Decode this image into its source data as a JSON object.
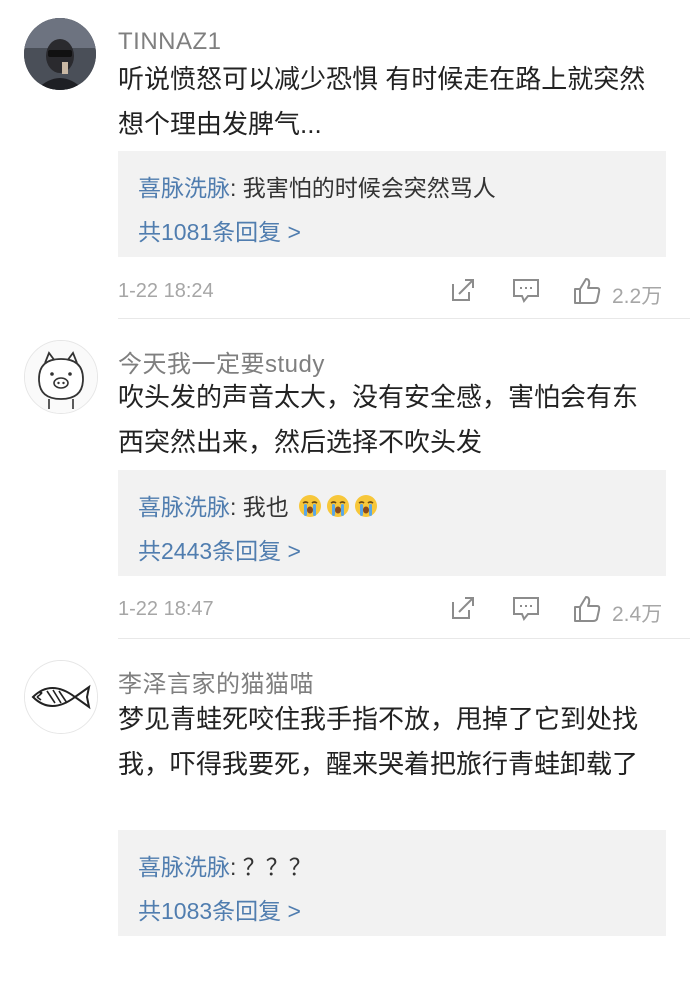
{
  "comments": [
    {
      "username": "TINNAZ1",
      "avatar": "photo-avatar",
      "text": "听说愤怒可以减少恐惧 有时候走在路上就突然想个理由发脾气...",
      "reply": {
        "author": "喜脉洗脉",
        "text": ": 我害怕的时候会突然骂人",
        "count_label": "共1081条回复 >"
      },
      "timestamp": "1-22 18:24",
      "likes": "2.2万"
    },
    {
      "username": "今天我一定要study",
      "avatar": "pig-avatar",
      "text": "吹头发的声音太大，没有安全感，害怕会有东西突然出来，然后选择不吹头发",
      "reply": {
        "author": "喜脉洗脉",
        "text": ": 我也",
        "emoji": "crying-emoji x3",
        "count_label": "共2443条回复 >"
      },
      "timestamp": "1-22 18:47",
      "likes": "2.4万"
    },
    {
      "username": "李泽言家的猫猫喵",
      "avatar": "fish-avatar",
      "text": "梦见青蛙死咬住我手指不放，甩掉了它到处找我，吓得我要死，醒来哭着把旅行青蛙卸载了",
      "reply": {
        "author": "喜脉洗脉",
        "text": ": ？？？",
        "count_label": "共1083条回复 >"
      }
    }
  ],
  "icons": [
    "share-icon",
    "comment-icon",
    "like-icon"
  ],
  "colors": {
    "link": "#507daf",
    "text": "#222222",
    "meta": "#a6a6a6",
    "reply_bg": "#f2f2f2"
  }
}
